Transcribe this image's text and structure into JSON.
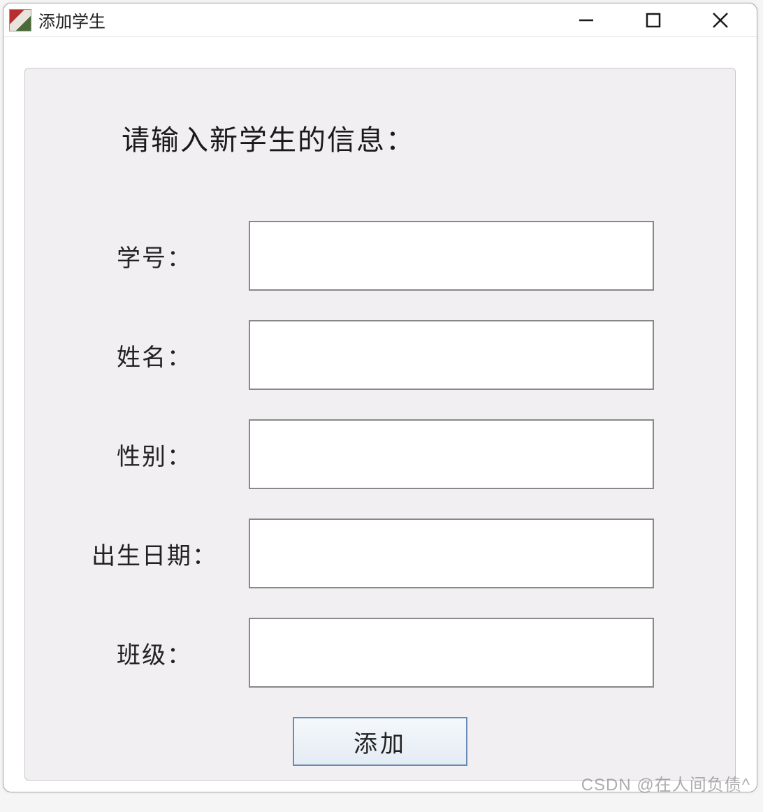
{
  "window": {
    "title": "添加学生"
  },
  "form": {
    "heading": "请输入新学生的信息：",
    "fields": {
      "student_id": {
        "label": "学号：",
        "value": ""
      },
      "name": {
        "label": "姓名：",
        "value": ""
      },
      "gender": {
        "label": "性别：",
        "value": ""
      },
      "birthdate": {
        "label": "出生日期：",
        "value": ""
      },
      "class": {
        "label": "班级：",
        "value": ""
      }
    },
    "submit_label": "添加"
  },
  "watermark": "CSDN @在人间负债^"
}
